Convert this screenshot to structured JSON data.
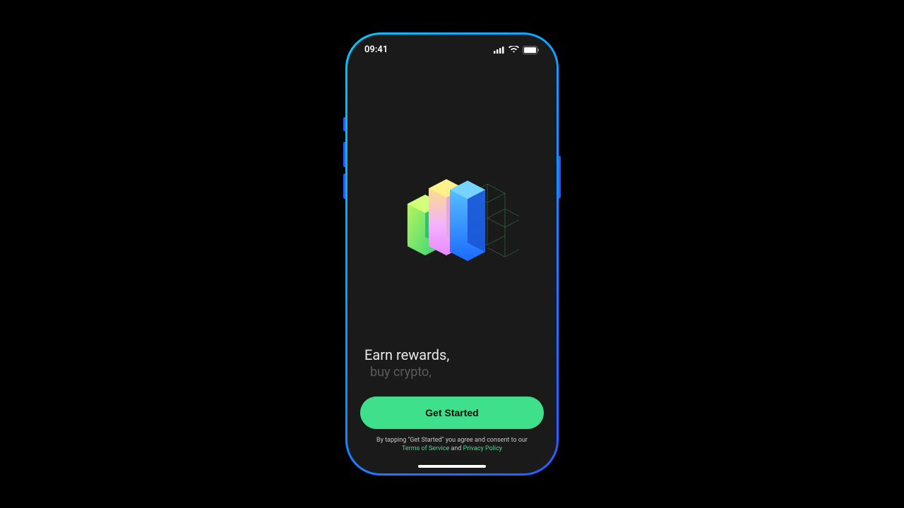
{
  "status": {
    "time": "09:41"
  },
  "headline": {
    "primary": "Earn rewards,",
    "secondary": "buy crypto,"
  },
  "cta": {
    "label": "Get Started"
  },
  "legal": {
    "prefix": "By tapping \"Get Started\" you agree and consent to our",
    "terms_label": "Terms of Service",
    "and": " and ",
    "privacy_label": "Privacy Policy"
  }
}
